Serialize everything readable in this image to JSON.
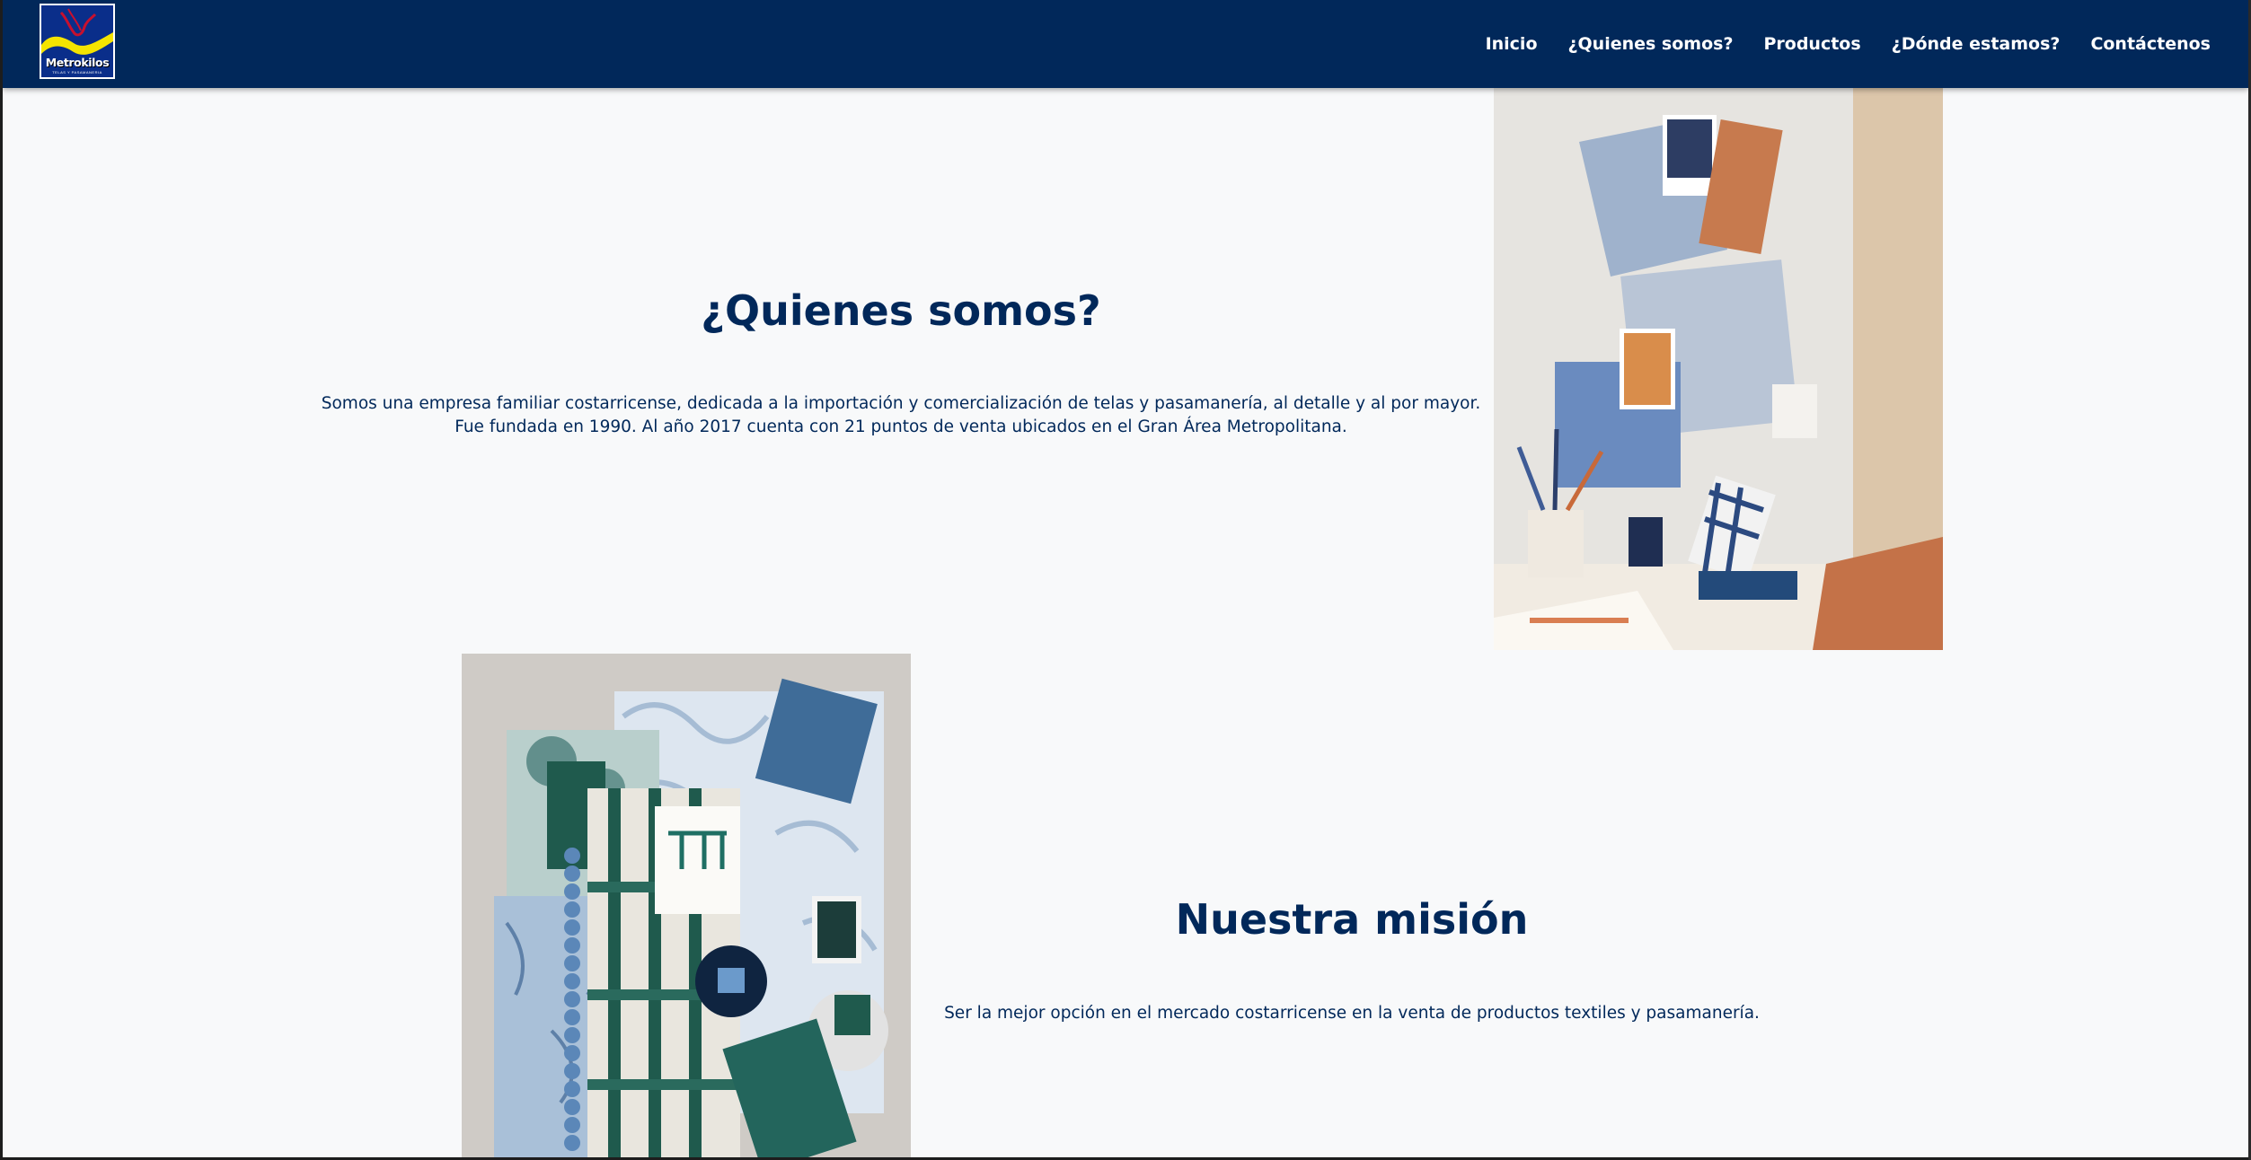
{
  "brand": {
    "name": "Metrokilos",
    "tagline": "TELAS Y PASAMANERIA",
    "colors": {
      "navy": "#01285a",
      "page_bg": "#f8f9fa",
      "logo_yellow": "#f5e400",
      "logo_red": "#c8102e"
    }
  },
  "nav": {
    "items": [
      {
        "label": "Inicio"
      },
      {
        "label": "¿Quienes somos?"
      },
      {
        "label": "Productos"
      },
      {
        "label": "¿Dónde estamos?"
      },
      {
        "label": "Contáctenos"
      }
    ]
  },
  "about": {
    "title": "¿Quienes somos?",
    "line1": "Somos una empresa familiar costarricense, dedicada a la importación y comercialización de telas y pasamanería, al detalle y al por mayor.",
    "line2": "Fue fundada en 1990. Al año 2017 cuenta con 21 puntos de venta ubicados en el Gran Área Metropolitana."
  },
  "mission": {
    "title": "Nuestra misión",
    "text": "Ser la mejor opción en el mercado costarricense en la venta de productos textiles y pasamanería."
  }
}
